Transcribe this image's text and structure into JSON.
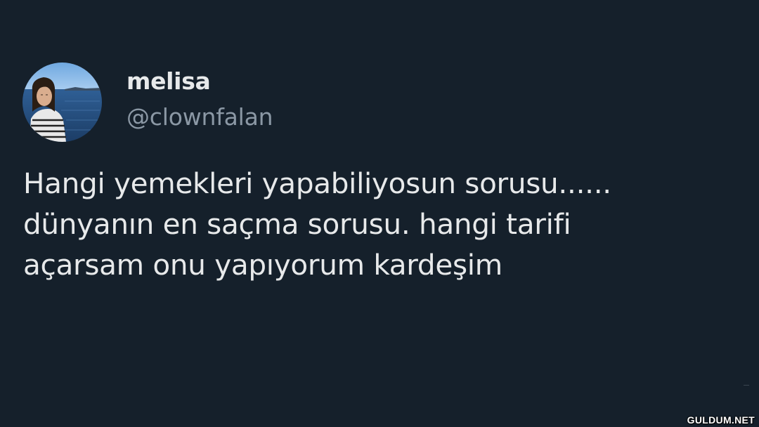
{
  "user": {
    "display_name": "melisa",
    "handle": "@clownfalan"
  },
  "tweet": {
    "lines": [
      "Hangi yemekleri yapabiliyosun sorusu......",
      "dünyanın en saçma sorusu. hangi tarifi",
      "açarsam onu yapıyorum kardeşim"
    ]
  },
  "watermark": "GULDUM.NET",
  "colors": {
    "background": "#15202b",
    "primary_text": "#e7e9ea",
    "secondary_text": "#8b98a5"
  }
}
